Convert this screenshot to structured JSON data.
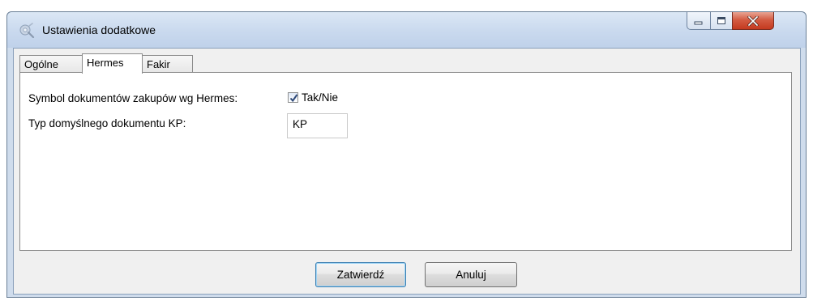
{
  "window": {
    "title": "Ustawienia dodatkowe",
    "icon": "settings-app-icon",
    "controls": {
      "minimize": "minimize-icon",
      "maximize": "maximize-icon",
      "close": "close-icon"
    }
  },
  "tabs": [
    {
      "label": "Ogólne",
      "active": false
    },
    {
      "label": "Hermes",
      "active": true
    },
    {
      "label": "Fakir",
      "active": false
    }
  ],
  "hermes": {
    "symbol_label": "Symbol dokumentów zakupów wg Hermes:",
    "symbol_checked": true,
    "symbol_check_label": "Tak/Nie",
    "kp_label": "Typ domyślnego dokumentu KP:",
    "kp_value": "KP"
  },
  "footer": {
    "confirm_label": "Zatwierdź",
    "cancel_label": "Anuluj"
  },
  "colors": {
    "titlebar": "#c9d9ee",
    "close_button": "#c4391f",
    "client_bg": "#f0f0f0"
  }
}
